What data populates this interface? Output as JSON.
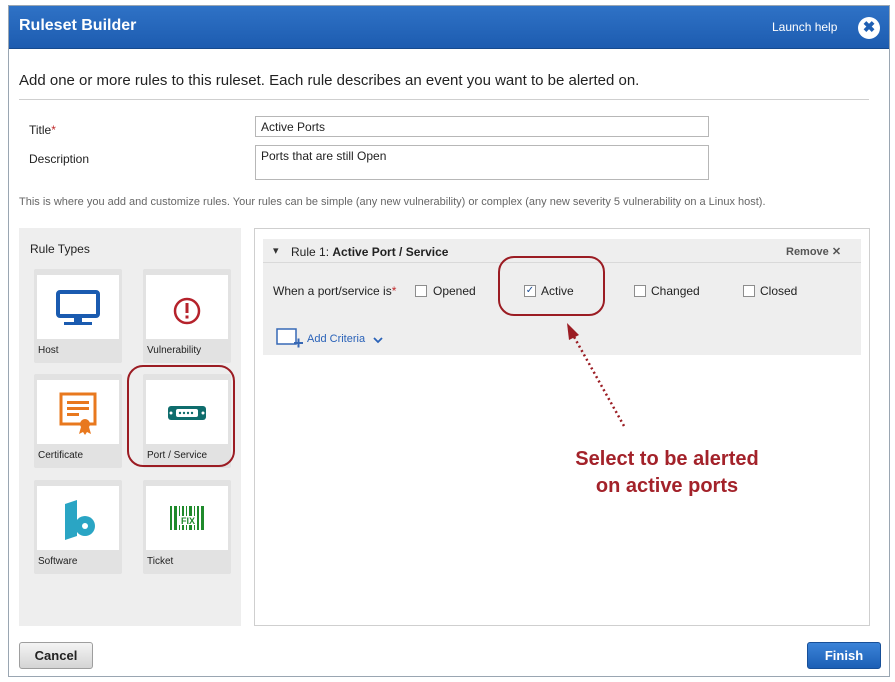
{
  "dialog": {
    "title": "Ruleset Builder",
    "help_link": "Launch help",
    "close_glyph": "✖",
    "intro": "Add one or more rules to this ruleset. Each rule describes an event you want to be alerted on."
  },
  "form": {
    "title_label": "Title",
    "required_mark": "*",
    "title_value": "Active Ports",
    "description_label": "Description",
    "description_value": "Ports that are still Open"
  },
  "hint": "This is where you add and customize rules. Your rules can be simple (any new vulnerability) or complex (any new severity 5 vulnerability on a Linux host).",
  "rule_types": {
    "heading": "Rule Types",
    "items": [
      {
        "label": "Host",
        "icon": "monitor-icon"
      },
      {
        "label": "Vulnerability",
        "icon": "exclamation-circle-icon"
      },
      {
        "label": "Certificate",
        "icon": "certificate-icon"
      },
      {
        "label": "Port / Service",
        "icon": "port-connector-icon"
      },
      {
        "label": "Software",
        "icon": "software-disc-icon"
      },
      {
        "label": "Ticket",
        "icon": "barcode-fix-icon"
      }
    ]
  },
  "rule": {
    "chevron": "▾",
    "prefix": "Rule 1:",
    "name": "Active Port / Service",
    "remove_label": "Remove ✕",
    "condition_label": "When a port/service is",
    "options": [
      {
        "label": "Opened",
        "checked": false
      },
      {
        "label": "Active",
        "checked": true
      },
      {
        "label": "Changed",
        "checked": false
      },
      {
        "label": "Closed",
        "checked": false
      }
    ],
    "add_criteria_label": "Add Criteria"
  },
  "annotation": {
    "line1": "Select to be alerted",
    "line2": "on active ports",
    "color": "#a3222a"
  },
  "footer": {
    "cancel_label": "Cancel",
    "finish_label": "Finish"
  },
  "colors": {
    "titlebar": "#2066bd",
    "accent_red": "#9b1c23",
    "link_blue": "#2a62b8"
  }
}
